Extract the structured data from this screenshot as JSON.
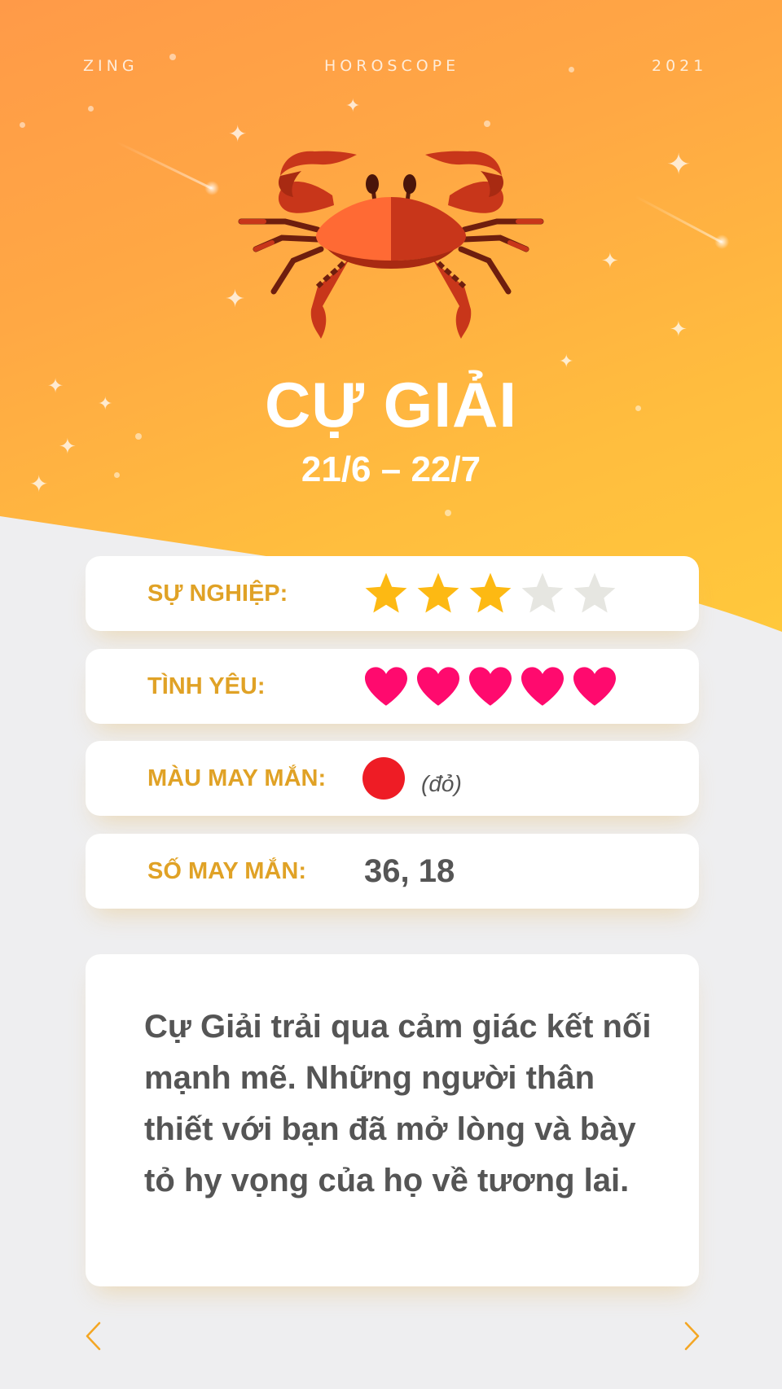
{
  "topbar": {
    "left": "ZING",
    "center": "HOROSCOPE",
    "right": "2021"
  },
  "sign": {
    "name": "CỰ GIẢI",
    "dates": "21/6 – 22/7"
  },
  "rows": {
    "career": {
      "label": "SỰ NGHIỆP:",
      "rating": 3,
      "max": 5
    },
    "love": {
      "label": "TÌNH YÊU:",
      "rating": 5,
      "max": 5
    },
    "lucky_color": {
      "label": "MÀU MAY MẮN:",
      "color": "#ee1c25",
      "name": "(đỏ)"
    },
    "lucky_number": {
      "label": "SỐ MAY MẮN:",
      "value": "36, 18"
    }
  },
  "description": "Cự Giải trải qua cảm giác kết nối mạnh mẽ. Những người thân thiết với bạn đã mở lòng và bày tỏ hy vọng của họ về tương lai.",
  "icons": {
    "prev": "chevron-left-icon",
    "next": "chevron-right-icon",
    "sign": "crab-icon"
  },
  "colors": {
    "accent": "#e0a226",
    "star_on": "#fdb913",
    "star_off": "#e6e6e1",
    "heart": "#ff0a6e",
    "text": "#555555"
  }
}
